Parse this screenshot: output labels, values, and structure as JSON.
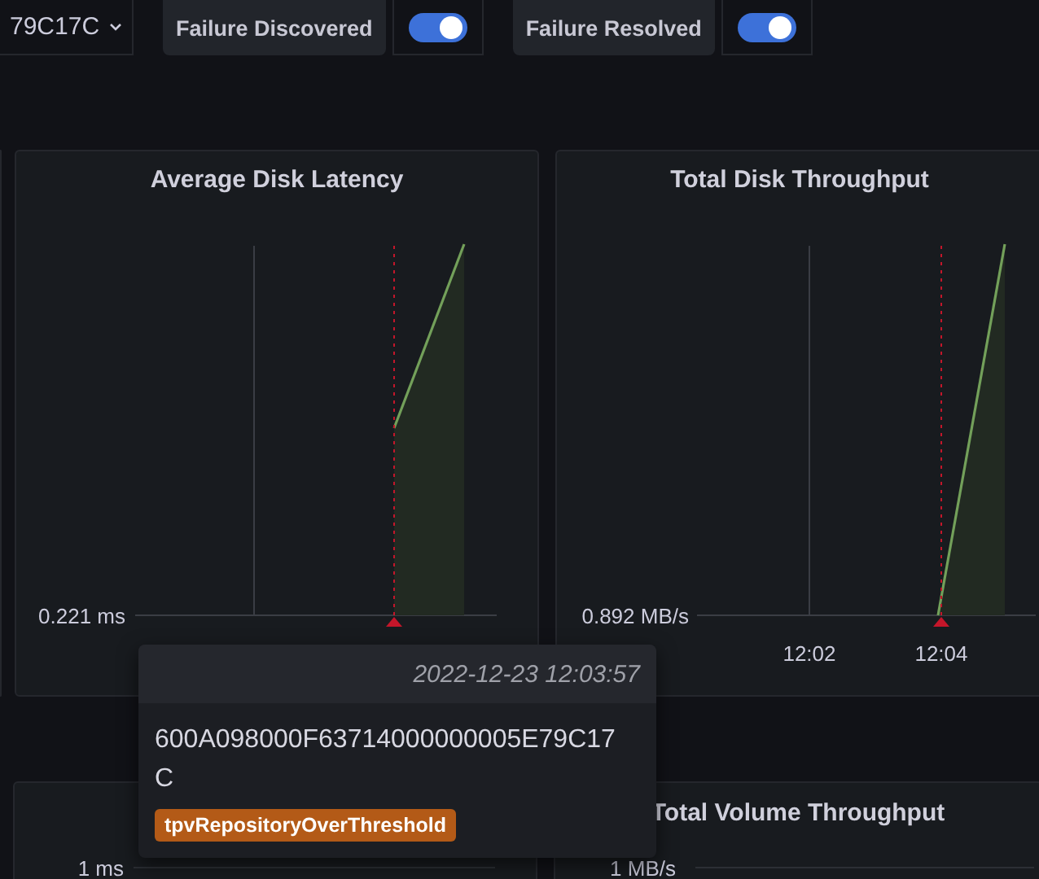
{
  "top_bar": {
    "dropdown": {
      "value": "79C17C"
    },
    "toggles": [
      {
        "label": "Failure Discovered",
        "on": true
      },
      {
        "label": "Failure Resolved",
        "on": true
      }
    ]
  },
  "chart_row": [
    {
      "title": "Average Disk Latency",
      "y_tick": "0.221 ms"
    },
    {
      "title": "Total Disk Throughput",
      "y_tick": "0.892 MB/s",
      "x_ticks": [
        "12:02",
        "12:04"
      ]
    }
  ],
  "bottom_row": [
    {
      "y_tick": "1 ms"
    },
    {
      "title": "Total Volume Throughput",
      "y_tick": "1 MB/s"
    }
  ],
  "tooltip": {
    "time": "2022-12-23 12:03:57",
    "text": "600A098000F63714000000005E79C17C",
    "tag": "tpvRepositoryOverThreshold"
  }
}
